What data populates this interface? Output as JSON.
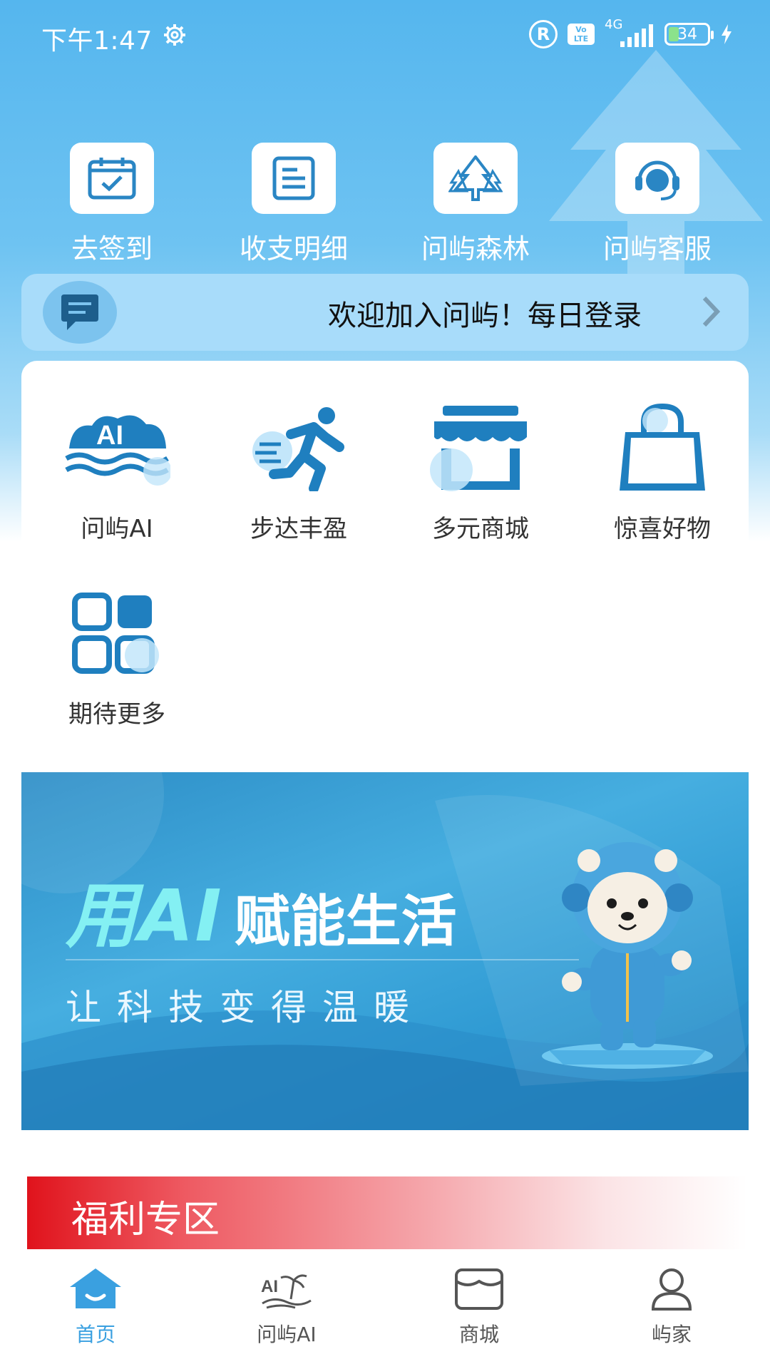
{
  "colors": {
    "primary": "#2f8fcf",
    "sky": "#55b6ee",
    "accent_light": "#a8dcfa",
    "welfare_red": "#e0131c",
    "active_nav": "#3aa0e0"
  },
  "status_bar": {
    "time": "下午1:47",
    "network": "4G",
    "volte": "Vo LTE",
    "registered": "R",
    "battery": "34"
  },
  "quick_actions": [
    {
      "label": "去签到",
      "icon": "calendar-check-icon"
    },
    {
      "label": "收支明细",
      "icon": "document-list-icon"
    },
    {
      "label": "问屿森林",
      "icon": "forest-icon"
    },
    {
      "label": "问屿客服",
      "icon": "customer-service-icon"
    }
  ],
  "notice": {
    "text": "欢迎加入问屿！每日登录",
    "icon": "message-icon"
  },
  "services": [
    {
      "label": "问屿AI",
      "icon": "ai-island-icon"
    },
    {
      "label": "步达丰盈",
      "icon": "running-man-icon"
    },
    {
      "label": "多元商城",
      "icon": "store-icon"
    },
    {
      "label": "惊喜好物",
      "icon": "shopping-bag-icon"
    },
    {
      "label": "期待更多",
      "icon": "more-grid-icon"
    }
  ],
  "banner": {
    "title_highlight": "用AI",
    "title_rest": "赋能生活",
    "subtitle": "让科技变得温暖"
  },
  "welfare": {
    "title": "福利专区"
  },
  "bottom_nav": [
    {
      "label": "首页",
      "icon": "home-icon",
      "active": true
    },
    {
      "label": "问屿AI",
      "icon": "ai-island-nav-icon",
      "active": false
    },
    {
      "label": "商城",
      "icon": "shop-nav-icon",
      "active": false
    },
    {
      "label": "屿家",
      "icon": "profile-icon",
      "active": false
    }
  ]
}
